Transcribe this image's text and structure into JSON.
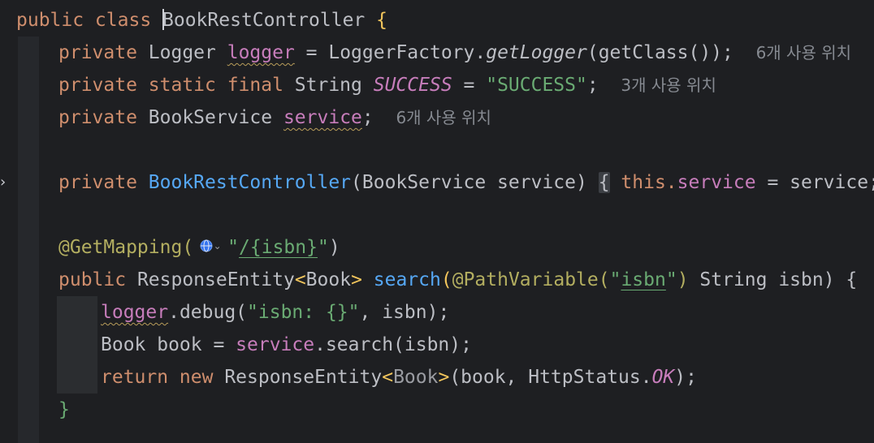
{
  "editor": {
    "language": "Java",
    "lines": {
      "l1": {
        "kw": "public class ",
        "name": "BookRestController",
        "brace": " {"
      },
      "l2": {
        "kw": "private ",
        "type": "Logger ",
        "field": "logger",
        "eq": " = ",
        "factory": "LoggerFactory.",
        "method": "getLogger",
        "args": "(getClass());",
        "hint": "6개 사용 위치"
      },
      "l3": {
        "kw": "private static final ",
        "type": "String ",
        "const": "SUCCESS",
        "eq": " = ",
        "str": "\"SUCCESS\"",
        "semi": ";",
        "hint": "3개 사용 위치"
      },
      "l4": {
        "kw": "private ",
        "type": "BookService ",
        "field": "service",
        "semi": ";",
        "hint": "6개 사용 위치"
      },
      "l5": {
        "kw": "private ",
        "ctor": "BookRestController",
        "params": "(BookService service)",
        "open": "{",
        "this": "this.",
        "field": "service",
        "assign": " = service;",
        "close": "}"
      },
      "l6": {
        "ann": "@GetMapping(",
        "str_open": "\"",
        "path": "/{isbn}",
        "str_close": "\"",
        "paren": ")"
      },
      "l7": {
        "kw": "public ",
        "type": "ResponseEntity",
        "gen_open": "<",
        "gen": "Book",
        "gen_close": "> ",
        "fn": "search",
        "p_open": "(",
        "ann": "@PathVariable(",
        "str_q1": "\"",
        "str_val": "isbn",
        "str_q2": "\"",
        "ann_close": ")",
        "rest": " String isbn) {"
      },
      "l8": {
        "field": "logger",
        "call": ".debug(",
        "str": "\"isbn: {}\"",
        "rest": ", isbn);"
      },
      "l9": {
        "a": "Book book = ",
        "field": "service",
        "b": ".search(isbn);"
      },
      "l10": {
        "kw": "return new ",
        "type": "ResponseEntity",
        "gen_open": "<",
        "gen": "Book",
        "gen_close": ">",
        "rest": "(book, HttpStatus.",
        "const": "OK",
        "end": ");"
      },
      "l11": {
        "brace": "}"
      }
    }
  },
  "icons": {
    "fold_marker": "chevron-right-icon",
    "globe": "globe-icon",
    "chip_chevron": "chevron-down-icon"
  },
  "colors": {
    "background": "#1e1f22",
    "keyword": "#cf8e6d",
    "function": "#56a8f5",
    "field": "#c77dbb",
    "string": "#6aab73",
    "annotation": "#b3ae60",
    "text": "#bcbec4",
    "hint": "#868a91"
  }
}
